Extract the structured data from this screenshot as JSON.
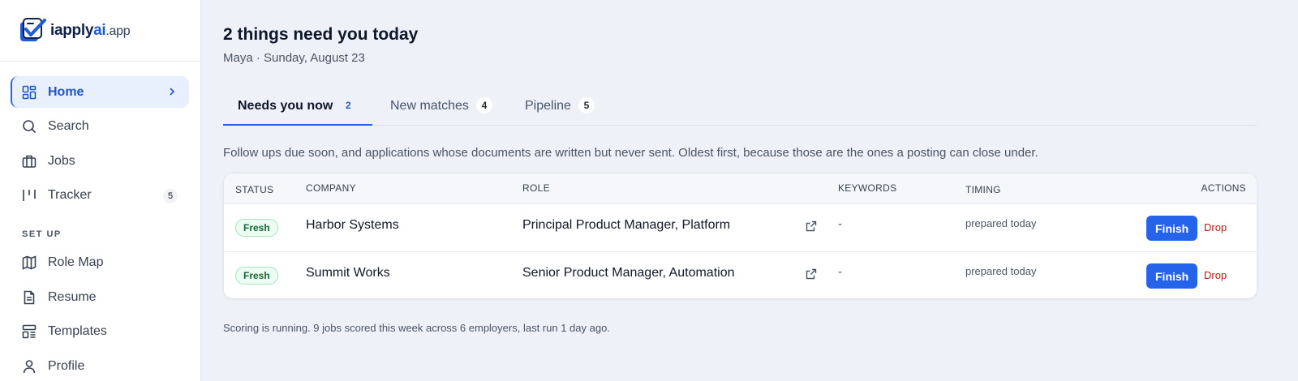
{
  "brand": {
    "name_pre": "iapply",
    "name_ai": "ai",
    "tld": ".app"
  },
  "sidebar": {
    "items": [
      {
        "label": "Home",
        "icon": "dashboard-icon"
      },
      {
        "label": "Search",
        "icon": "search-icon"
      },
      {
        "label": "Jobs",
        "icon": "briefcase-icon"
      },
      {
        "label": "Tracker",
        "icon": "kanban-icon",
        "badge": "5"
      }
    ],
    "section_label": "SET UP",
    "setup_items": [
      {
        "label": "Role Map",
        "icon": "map-icon"
      },
      {
        "label": "Resume",
        "icon": "document-icon"
      },
      {
        "label": "Templates",
        "icon": "layout-icon"
      },
      {
        "label": "Profile",
        "icon": "user-icon"
      }
    ]
  },
  "header": {
    "title": "2 things need you today",
    "subtitle": "Maya · Sunday, August 23"
  },
  "tabs": [
    {
      "label": "Needs you now",
      "count": "2",
      "active": true
    },
    {
      "label": "New matches",
      "count": "4",
      "active": false
    },
    {
      "label": "Pipeline",
      "count": "5",
      "active": false
    }
  ],
  "description": "Follow ups due soon, and applications whose documents are written but never sent. Oldest first, because those are the ones a posting can close under.",
  "table": {
    "columns": {
      "status": "STATUS",
      "company": "COMPANY",
      "role": "ROLE",
      "keywords": "KEYWORDS",
      "timing": "TIMING",
      "actions": "ACTIONS"
    },
    "rows": [
      {
        "status": "Fresh",
        "company": "Harbor Systems",
        "role": "Principal Product Manager, Platform",
        "keywords": "-",
        "timing": "prepared today",
        "finish": "Finish",
        "drop": "Drop"
      },
      {
        "status": "Fresh",
        "company": "Summit Works",
        "role": "Senior Product Manager, Automation",
        "keywords": "-",
        "timing": "prepared today",
        "finish": "Finish",
        "drop": "Drop"
      }
    ]
  },
  "footer_note": "Scoring is running. 9 jobs scored this week across 6 employers, last run 1 day ago.",
  "colors": {
    "accent": "#2563eb",
    "fresh_bg": "#ecfdf3",
    "fresh_text": "#166534",
    "drop": "#b42318"
  }
}
